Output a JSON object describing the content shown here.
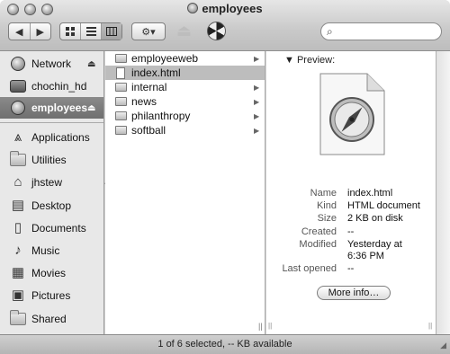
{
  "window": {
    "title": "employees"
  },
  "toolbar": {
    "back_label": "◀",
    "forward_label": "▶",
    "action_label": "⚙▾",
    "search_placeholder": ""
  },
  "sidebar": {
    "devices": [
      {
        "label": "Network",
        "icon": "network-globe-icon",
        "eject": "⏏"
      },
      {
        "label": "chochin_hd",
        "icon": "hard-disk-icon",
        "eject": ""
      },
      {
        "label": "employees",
        "icon": "shared-volume-icon",
        "eject": "⏏",
        "selected": true
      }
    ],
    "places": [
      {
        "label": "Applications",
        "icon": "applications-icon"
      },
      {
        "label": "Utilities",
        "icon": "folder-icon"
      },
      {
        "label": "jhstew",
        "icon": "home-icon"
      },
      {
        "label": "Desktop",
        "icon": "desktop-icon"
      },
      {
        "label": "Documents",
        "icon": "documents-icon"
      },
      {
        "label": "Music",
        "icon": "music-icon"
      },
      {
        "label": "Movies",
        "icon": "movies-icon"
      },
      {
        "label": "Pictures",
        "icon": "pictures-icon"
      },
      {
        "label": "Shared",
        "icon": "folder-icon"
      }
    ]
  },
  "column1": {
    "items": [
      {
        "label": "employeeweb",
        "type": "folder",
        "has_children": true
      },
      {
        "label": "index.html",
        "type": "file",
        "has_children": false,
        "selected": true
      },
      {
        "label": "internal",
        "type": "folder",
        "has_children": true
      },
      {
        "label": "news",
        "type": "folder",
        "has_children": true
      },
      {
        "label": "philanthropy",
        "type": "folder",
        "has_children": true
      },
      {
        "label": "softball",
        "type": "folder",
        "has_children": true
      }
    ]
  },
  "preview": {
    "heading": "Preview:",
    "info": [
      {
        "key": "Name",
        "value": "index.html"
      },
      {
        "key": "Kind",
        "value": "HTML document"
      },
      {
        "key": "Size",
        "value": "2 KB on disk"
      },
      {
        "key": "Created",
        "value": "--"
      },
      {
        "key": "Modified",
        "value": "Yesterday at"
      },
      {
        "key": "",
        "value": "6:36 PM"
      },
      {
        "key": "Last opened",
        "value": "--"
      }
    ],
    "more_info_label": "More info…"
  },
  "status": {
    "text": "1 of 6 selected, -- KB available"
  }
}
